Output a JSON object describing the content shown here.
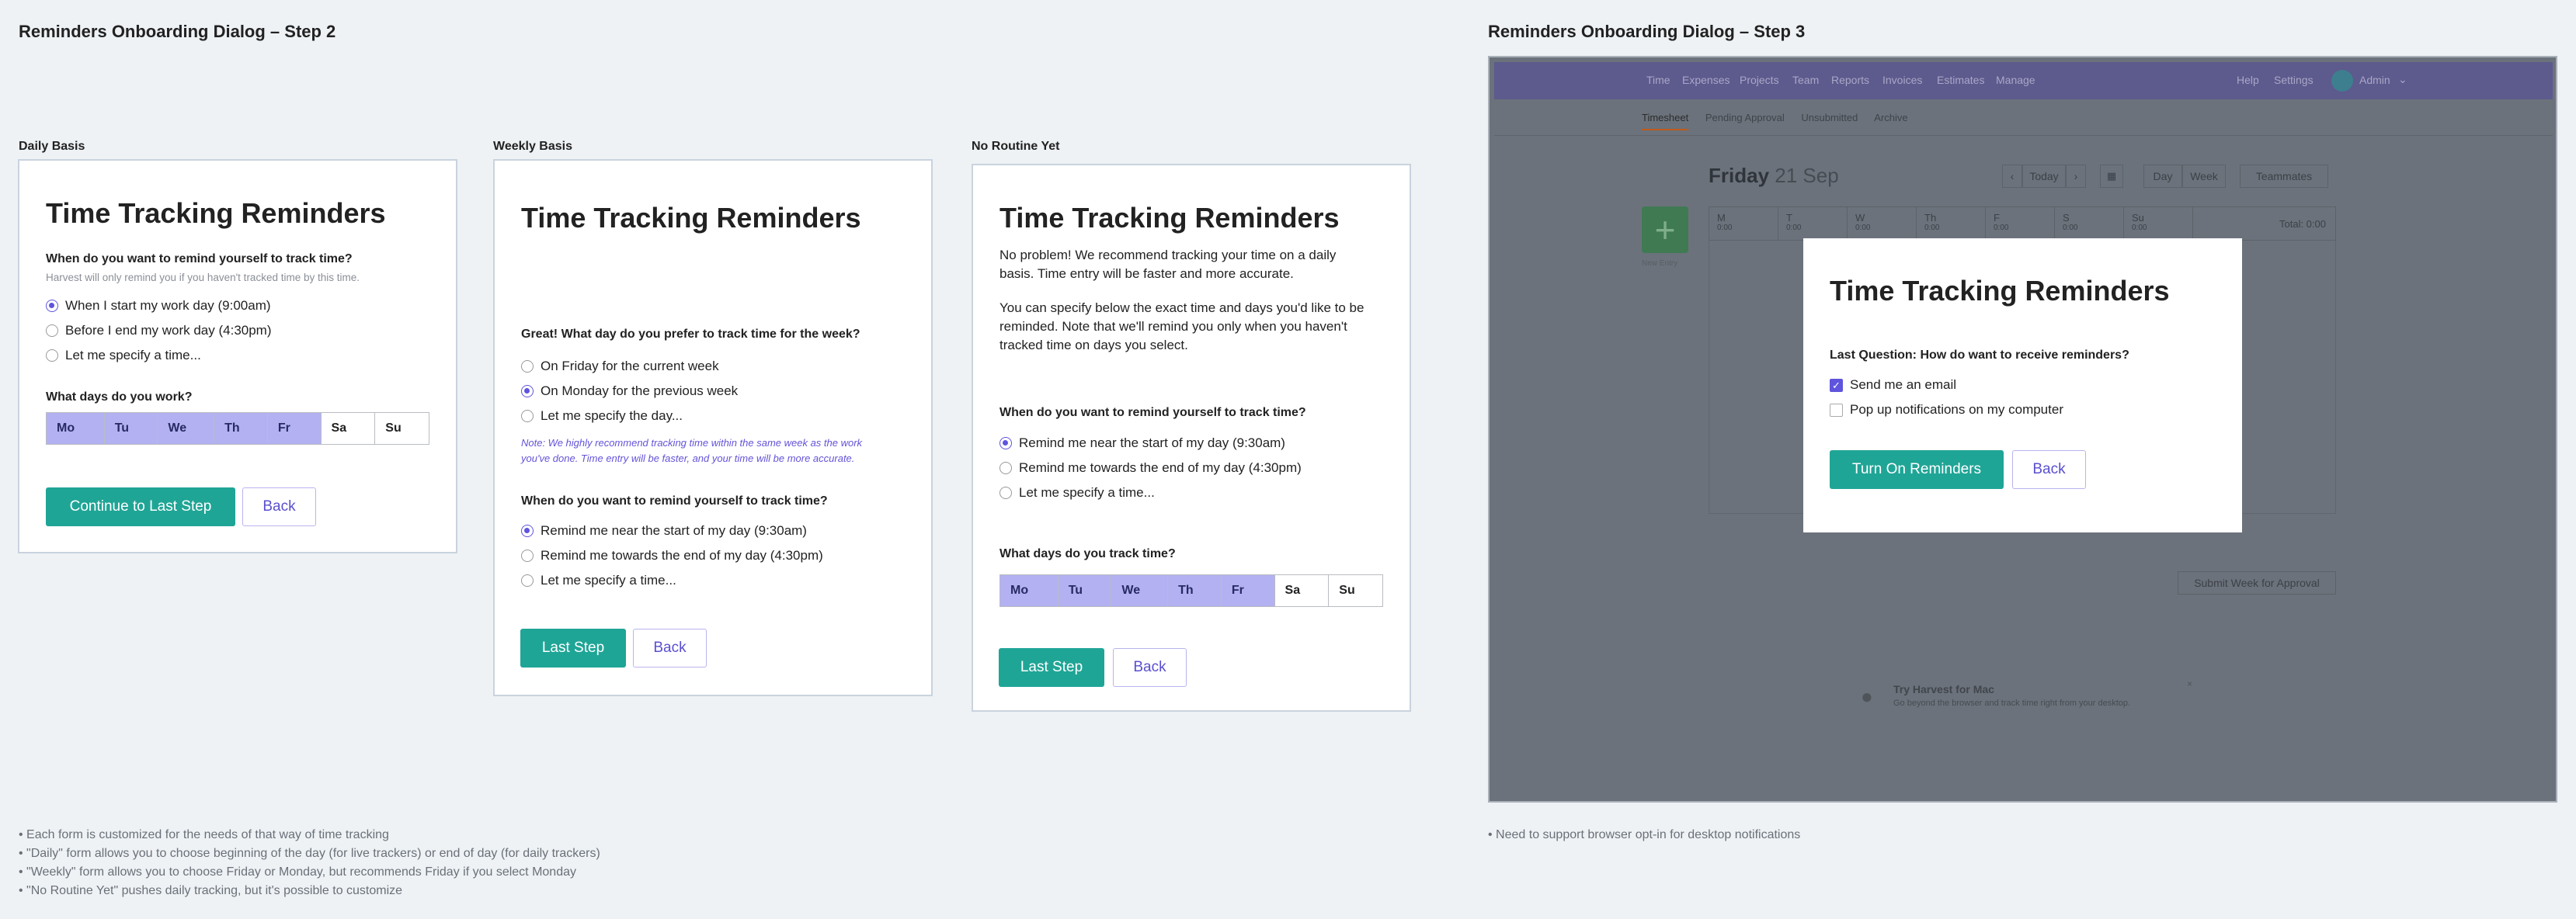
{
  "left_title": "Reminders Onboarding Dialog – Step 2",
  "right_title": "Reminders Onboarding Dialog – Step 3",
  "panels": {
    "daily": {
      "label": "Daily Basis",
      "heading": "Time Tracking Reminders",
      "question": "When do you want to remind yourself to track time?",
      "hint": "Harvest will only remind you if you haven't tracked time by this time.",
      "options": [
        "When I start my work day (9:00am)",
        "Before I end my work day (4:30pm)",
        "Let me specify a time..."
      ],
      "selected_option": 0,
      "days_question": "What days do you work?",
      "days": [
        "Mo",
        "Tu",
        "We",
        "Th",
        "Fr",
        "Sa",
        "Su"
      ],
      "days_selected": [
        true,
        true,
        true,
        true,
        true,
        false,
        false
      ],
      "primary_button": "Continue to Last Step",
      "back_button": "Back"
    },
    "weekly": {
      "label": "Weekly Basis",
      "heading": "Time Tracking Reminders",
      "question": "Great! What day do you prefer to track time for the week?",
      "options": [
        "On Friday for the current week",
        "On Monday for the previous week",
        "Let me specify the day..."
      ],
      "selected_option": 1,
      "note_line1": "Note: We highly recommend tracking time within the same week as the work",
      "note_line2": "you've done. Time entry will be faster, and your time will be more accurate.",
      "question2": "When do you want to remind yourself to track time?",
      "options2": [
        "Remind me near the start of my day (9:30am)",
        "Remind me towards the end of my day (4:30pm)",
        "Let me specify a time..."
      ],
      "selected_option2": 0,
      "primary_button": "Last Step",
      "back_button": "Back"
    },
    "no_routine": {
      "label": "No Routine Yet",
      "heading": "Time Tracking Reminders",
      "para1_line1": "No problem! We recommend tracking your time on a daily",
      "para1_line2": "basis. Time entry will be faster and more accurate.",
      "para2_line1": "You can specify below the exact time and days you'd like to be",
      "para2_line2": "reminded. Note that we'll remind you only when you haven't",
      "para2_line3": "tracked time on days you select.",
      "question": "When do you want to remind yourself to track time?",
      "options": [
        "Remind me near the start of my day (9:30am)",
        "Remind me towards the end of my day (4:30pm)",
        "Let me specify a time..."
      ],
      "selected_option": 0,
      "days_question": "What days do you track time?",
      "days": [
        "Mo",
        "Tu",
        "We",
        "Th",
        "Fr",
        "Sa",
        "Su"
      ],
      "days_selected": [
        true,
        true,
        true,
        true,
        true,
        false,
        false
      ],
      "primary_button": "Last Step",
      "back_button": "Back"
    }
  },
  "left_notes": [
    "• Each form is customized for the needs of that way of time tracking",
    "• \"Daily\" form allows you to choose beginning of the day (for live trackers) or end of day (for daily trackers)",
    "• \"Weekly\" form allows you to choose Friday or Monday, but recommends Friday if you select Monday",
    "• \"No Routine Yet\" pushes daily tracking, but it's possible to customize"
  ],
  "right_notes": [
    "• Need to support browser opt-in for desktop notifications"
  ],
  "screenshot": {
    "nav_items": [
      "Time",
      "Expenses",
      "Projects",
      "Team",
      "Reports",
      "Invoices",
      "Estimates",
      "Manage"
    ],
    "nav_right": [
      "Help",
      "Settings",
      "Admin"
    ],
    "subnav": [
      "Timesheet",
      "Pending Approval",
      "Unsubmitted",
      "Archive"
    ],
    "date_day": "Friday",
    "date_rest": "21 Sep",
    "today_button": "Today",
    "view_day": "Day",
    "view_week": "Week",
    "teammates": "Teammates",
    "new_entry": "New Entry",
    "week_days": [
      "M",
      "T",
      "W",
      "Th",
      "F",
      "S",
      "Su"
    ],
    "week_values": [
      "0:00",
      "0:00",
      "0:00",
      "0:00",
      "0:00",
      "0:00",
      "0:00"
    ],
    "total_label": "Total: 0:00",
    "submit_button": "Submit Week for Approval",
    "promo_title": "Try Harvest for Mac",
    "promo_text": "Go beyond the browser and track time right from your desktop.",
    "modal": {
      "heading": "Time Tracking Reminders",
      "question": "Last Question: How do want to receive reminders?",
      "options": [
        "Send me an email",
        "Pop up notifications on my computer"
      ],
      "checked": [
        true,
        false
      ],
      "primary_button": "Turn On Reminders",
      "back_button": "Back"
    }
  },
  "colors": {
    "accent_purple": "#5f54de",
    "day_selected": "#b3b1f2",
    "primary_green": "#1fa596",
    "background": "#eef2f5"
  }
}
